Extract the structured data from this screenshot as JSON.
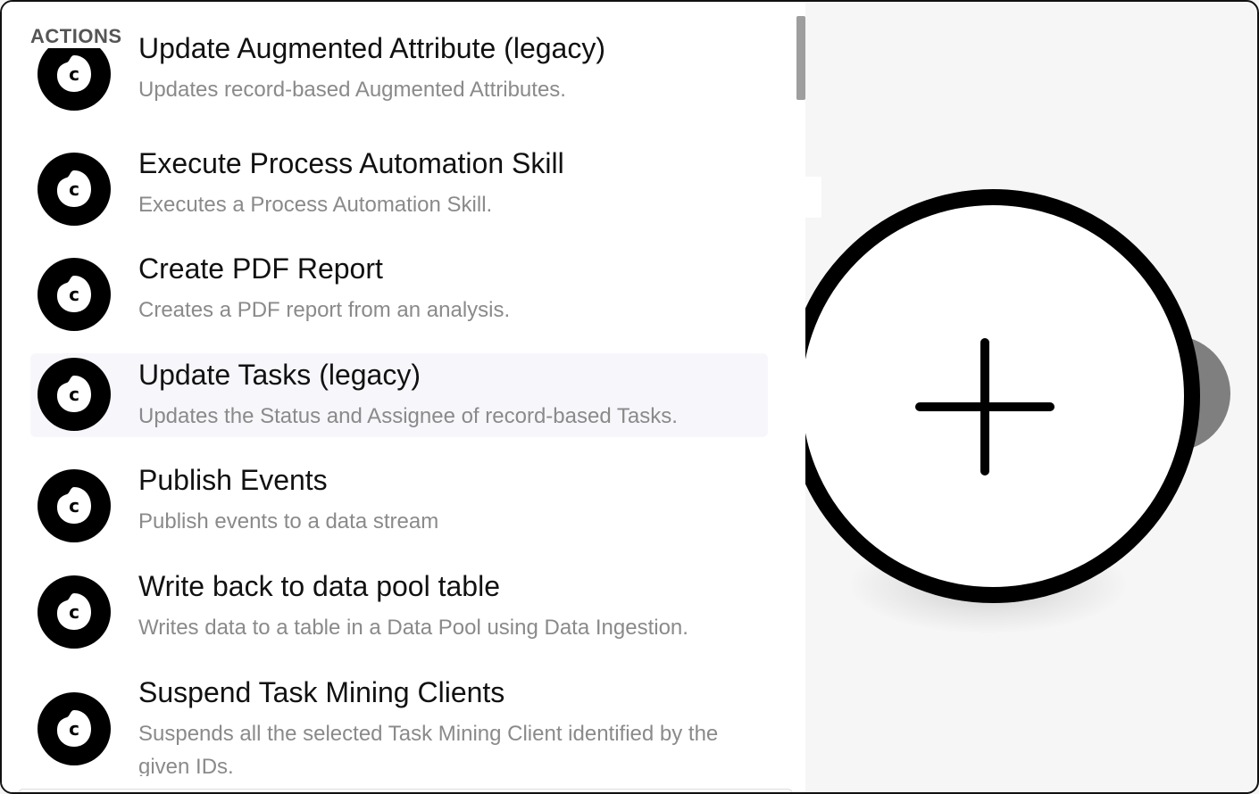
{
  "panel": {
    "section_title": "ACTIONS",
    "items": [
      {
        "title": "Update Augmented Attribute (legacy)",
        "description": "Updates record-based Augmented Attributes.",
        "icon": "celonis-logo-icon",
        "highlighted": false
      },
      {
        "title": "Execute Process Automation Skill",
        "description": "Executes a Process Automation Skill.",
        "icon": "celonis-logo-icon",
        "highlighted": false
      },
      {
        "title": "Create PDF Report",
        "description": "Creates a PDF report from an analysis.",
        "icon": "celonis-logo-icon",
        "highlighted": false
      },
      {
        "title": "Update Tasks (legacy)",
        "description": "Updates the Status and Assignee of record-based Tasks.",
        "icon": "celonis-logo-icon",
        "highlighted": true
      },
      {
        "title": "Publish Events",
        "description": "Publish events to a data stream",
        "icon": "celonis-logo-icon",
        "highlighted": false
      },
      {
        "title": "Write back to data pool table",
        "description": "Writes data to a table in a Data Pool using Data Ingestion.",
        "icon": "celonis-logo-icon",
        "highlighted": false
      },
      {
        "title": "Suspend Task Mining Clients",
        "description": "Suspends all the selected Task Mining Client identified by the given IDs.",
        "icon": "celonis-logo-icon",
        "highlighted": false
      }
    ]
  },
  "canvas": {
    "add_node_icon": "plus-icon",
    "neighbor_node_color": "#7f7f7f"
  }
}
